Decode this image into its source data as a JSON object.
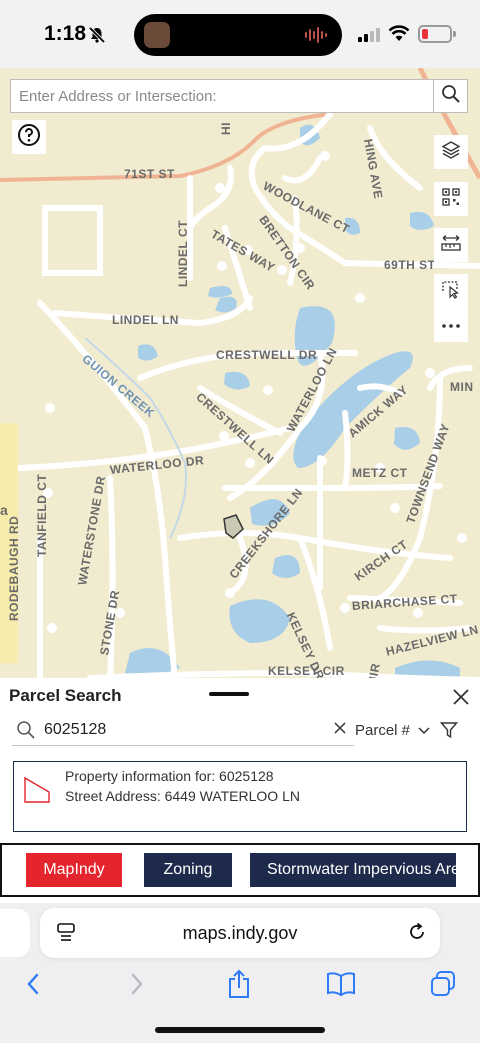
{
  "status_bar": {
    "time": "1:18",
    "battery_color": "#e8343a"
  },
  "map": {
    "search_placeholder": "Enter Address or Intersection:",
    "tools": [
      "search-icon",
      "help-icon",
      "layers-icon",
      "qr-code-icon",
      "measure-icon",
      "select-icon",
      "more-icon"
    ],
    "street_labels": {
      "st71": "71ST ST",
      "woodlane": "WOODLANE CT",
      "bretton": "BRETTON CIR",
      "tates": "TATES WAY",
      "st69": "69TH ST",
      "lindel_ct": "LINDEL CT",
      "lindel_ln": "LINDEL LN",
      "crestwell_dr": "CRESTWELL DR",
      "crestwell_ln": "CRESTWELL LN",
      "waterloo_ln": "WATERLOO LN",
      "amick": "AMICK WAY",
      "metz": "METZ CT",
      "townsend": "TOWNSEND WAY",
      "waterloo_dr": "WATERLOO DR",
      "tanfield": "TANFIELD CT",
      "waterstone": "WATERSTONE DR",
      "rodebaugh": "RODEBAUGH RD",
      "stone_dr": "STONE DR",
      "creekshore": "CREEKSHORE LN",
      "kelsey_dr": "KELSEY DR",
      "kirch": "KIRCH CT",
      "briarchase": "BRIARCHASE CT",
      "hazelview": "HAZELVIEW LN",
      "kelsey_cir": "KELSEY CIR",
      "hing": "HING AVE",
      "min": "MIN",
      "fragment_a": "a",
      "fragment_hi": "HI",
      "fragment_hir": "HIR",
      "fragment_hi2": "HI"
    },
    "water_labels": {
      "guion": "GUION CREEK"
    }
  },
  "parcel_panel": {
    "title": "Parcel Search",
    "search_value": "6025128",
    "search_by": "Parcel #",
    "result": {
      "line1": "Property information for: 6025128",
      "line2": "Street Address: 6449  WATERLOO LN"
    },
    "links": [
      {
        "label": "MapIndy",
        "color": "#e4252d"
      },
      {
        "label": "Zoning",
        "color": "#1d2a4b"
      },
      {
        "label": "Stormwater Impervious Are",
        "color": "#1d2a4b"
      }
    ]
  },
  "safari": {
    "url": "maps.indy.gov",
    "toolbar": [
      "back-icon",
      "forward-icon",
      "share-icon",
      "bookmarks-icon",
      "tabs-icon"
    ]
  }
}
